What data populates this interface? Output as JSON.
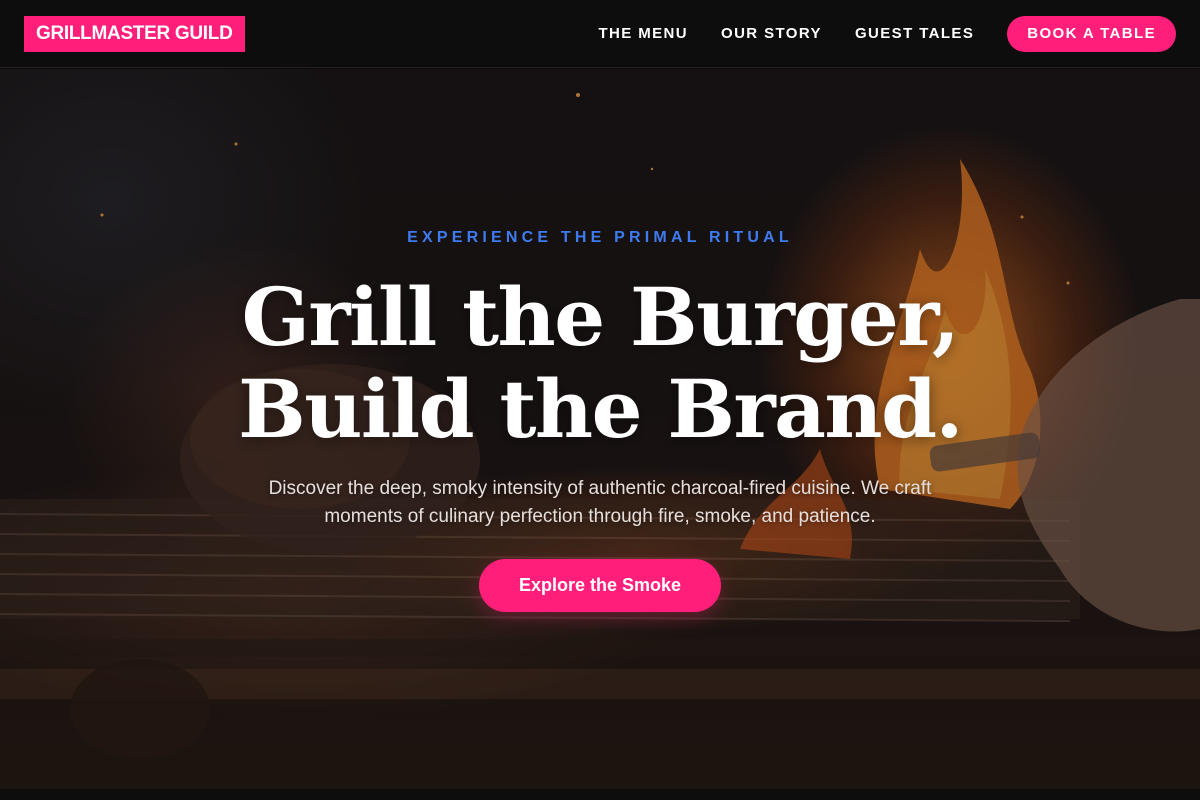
{
  "header": {
    "logo": "GRILLMASTER GUILD",
    "nav": [
      {
        "label": "THE MENU"
      },
      {
        "label": "OUR STORY"
      },
      {
        "label": "GUEST TALES"
      }
    ],
    "cta": "BOOK A TABLE"
  },
  "hero": {
    "eyebrow": "EXPERIENCE THE PRIMAL RITUAL",
    "headline_line1": "Grill the Burger,",
    "headline_line2": "Build the Brand.",
    "description": "Discover the deep, smoky intensity of authentic charcoal-fired cuisine. We craft moments of culinary perfection through fire, smoke, and patience.",
    "cta": "Explore the Smoke"
  },
  "colors": {
    "accent": "#ff1f7a",
    "eyebrow": "#3f7bf0",
    "background": "#0e0d0d"
  }
}
